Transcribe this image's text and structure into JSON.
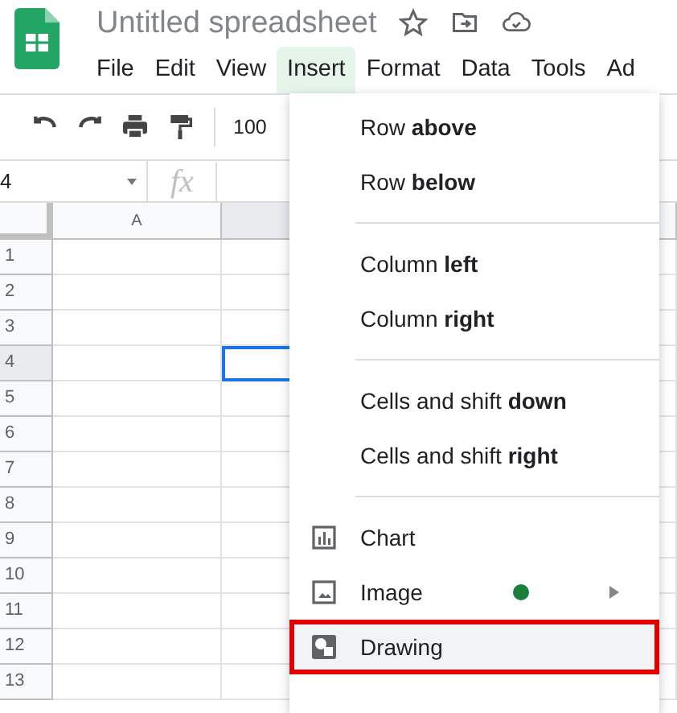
{
  "app": {
    "title": "Untitled spreadsheet"
  },
  "menu_bar": [
    {
      "label": "File",
      "selected": false
    },
    {
      "label": "Edit",
      "selected": false
    },
    {
      "label": "View",
      "selected": false
    },
    {
      "label": "Insert",
      "selected": true
    },
    {
      "label": "Format",
      "selected": false
    },
    {
      "label": "Data",
      "selected": false
    },
    {
      "label": "Tools",
      "selected": false
    },
    {
      "label": "Ad",
      "selected": false
    }
  ],
  "toolbar": {
    "zoom": "100"
  },
  "name_box": {
    "value": "4"
  },
  "formula_bar": {
    "label": "fx"
  },
  "columns": [
    {
      "label": "A",
      "selected": false
    },
    {
      "selected": true
    }
  ],
  "rows": [
    {
      "label": "1",
      "selected": false
    },
    {
      "label": "2",
      "selected": false
    },
    {
      "label": "3",
      "selected": false
    },
    {
      "label": "4",
      "selected": true
    },
    {
      "label": "5",
      "selected": false
    },
    {
      "label": "6",
      "selected": false
    },
    {
      "label": "7",
      "selected": false
    },
    {
      "label": "8",
      "selected": false
    },
    {
      "label": "9",
      "selected": false
    },
    {
      "label": "10",
      "selected": false
    },
    {
      "label": "11",
      "selected": false
    },
    {
      "label": "12",
      "selected": false
    },
    {
      "label": "13",
      "selected": false
    }
  ],
  "insert_menu": {
    "groups": [
      [
        {
          "label": "Row **above**",
          "kind": "text"
        },
        {
          "label": "Row **below**",
          "kind": "text"
        }
      ],
      [
        {
          "label": "Column **left**",
          "kind": "text"
        },
        {
          "label": "Column **right**",
          "kind": "text"
        }
      ],
      [
        {
          "label": "Cells and shift **down**",
          "kind": "text"
        },
        {
          "label": "Cells and shift **right**",
          "kind": "text"
        }
      ],
      [
        {
          "label": "Chart",
          "kind": "chart"
        },
        {
          "label": "Image",
          "kind": "image",
          "new_dot": true,
          "submenu": true
        },
        {
          "label": "Drawing",
          "kind": "drawing",
          "highlighted": true,
          "outlined": true
        }
      ]
    ]
  }
}
